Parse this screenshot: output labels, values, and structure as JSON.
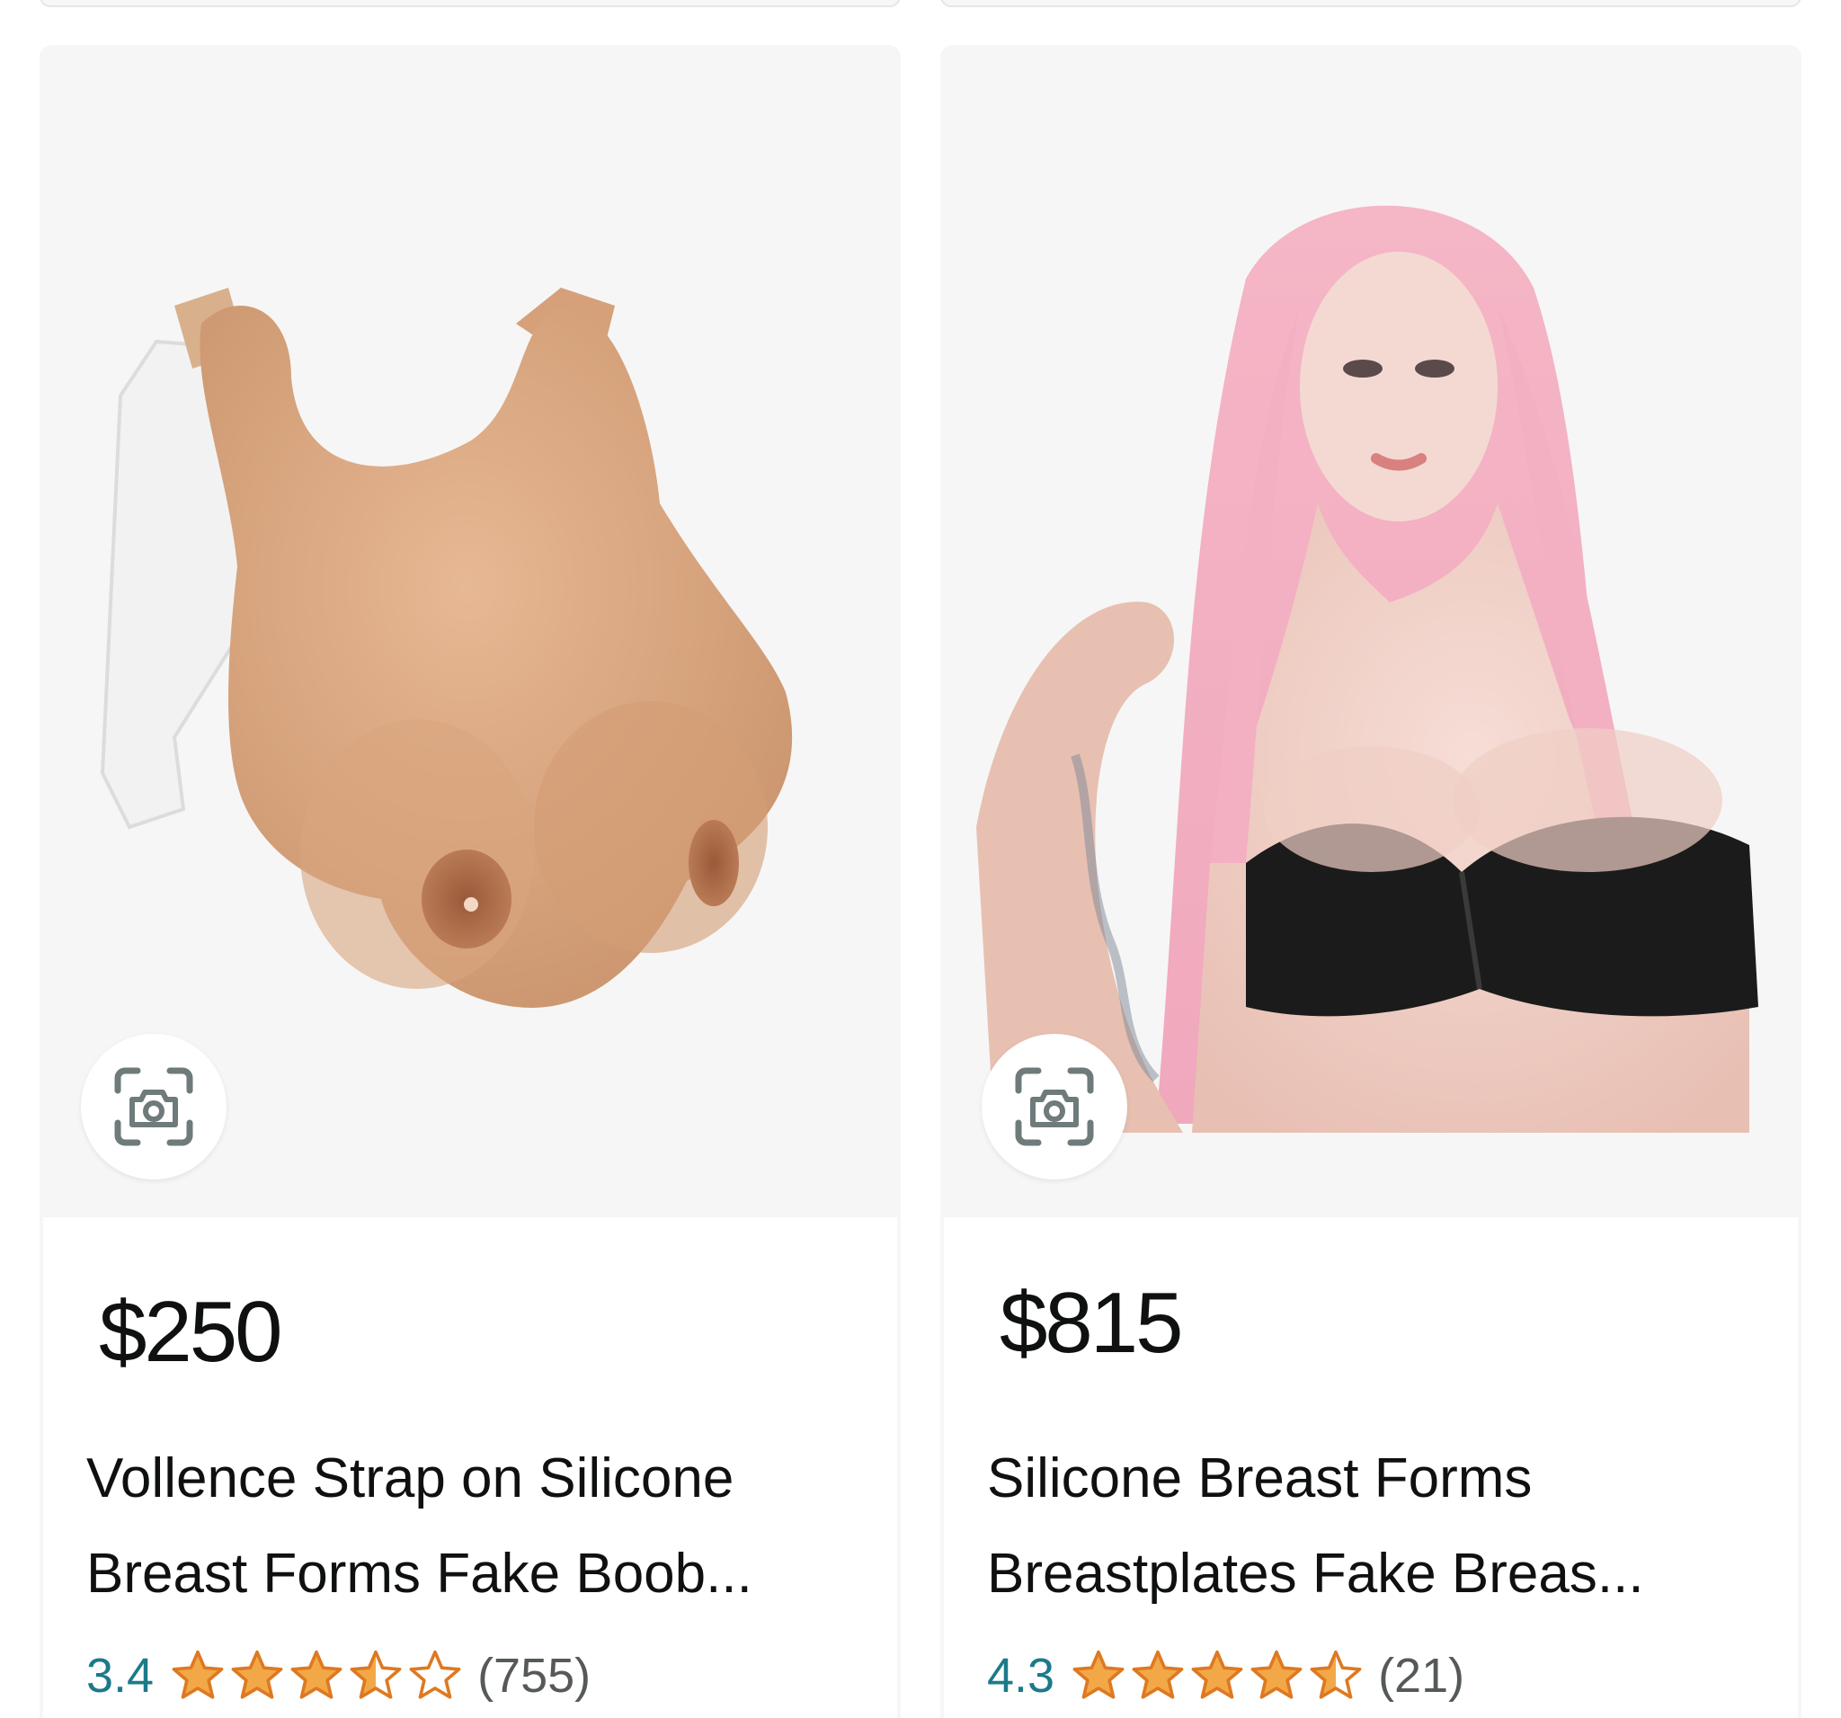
{
  "products": [
    {
      "image_alt": "product-photo",
      "price": "$250",
      "title_line_1": "Vollence Strap on Silicone",
      "title_line_2": "Breast Forms Fake Boob...",
      "rating": "3.4",
      "rating_stars": 3.4,
      "review_count": "(755)"
    },
    {
      "image_alt": "product-photo",
      "price": "$815",
      "title_line_1": "Silicone Breast Forms",
      "title_line_2": "Breastplates Fake Breas...",
      "rating": "4.3",
      "rating_stars": 4.3,
      "review_count": "(21)"
    }
  ],
  "colors": {
    "star": "#f3a847",
    "rating_text": "#1b7a8a",
    "price_text": "#0f1111",
    "secondary_text": "#565959"
  },
  "icons": {
    "visual_search": "camera-lens-icon",
    "star_full": "star-full-icon",
    "star_half": "star-half-icon",
    "star_empty": "star-empty-icon"
  }
}
